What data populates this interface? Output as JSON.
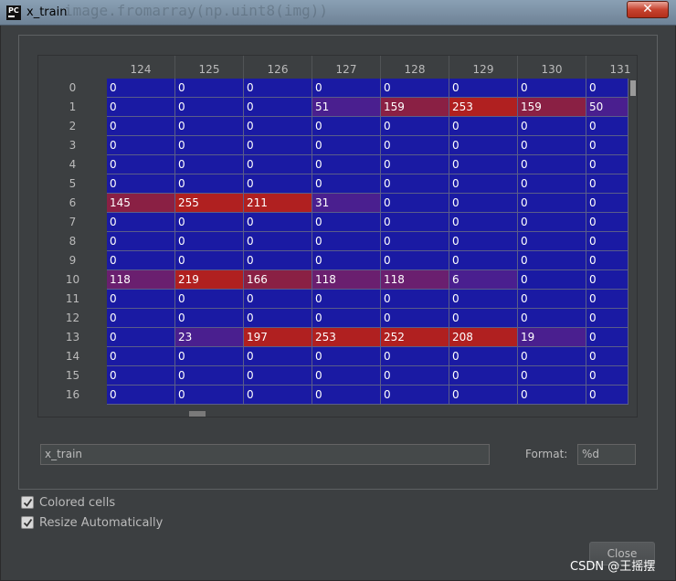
{
  "window": {
    "title": "x_train",
    "background_code": "image.fromarray(np.uint8(img))",
    "app_icon": "pycharm-icon"
  },
  "colors": {
    "zero_cell": "#1a1aa3",
    "high_cell": "#b02020",
    "mid_cell": "#6a1f6f",
    "panel_bg": "#3c3f41"
  },
  "grid": {
    "columns": [
      "124",
      "125",
      "126",
      "127",
      "128",
      "129",
      "130",
      "131"
    ],
    "rows": [
      {
        "label": "0",
        "values": [
          "0",
          "0",
          "0",
          "0",
          "0",
          "0",
          "0",
          "0"
        ]
      },
      {
        "label": "1",
        "values": [
          "0",
          "0",
          "0",
          "51",
          "159",
          "253",
          "159",
          "50"
        ]
      },
      {
        "label": "2",
        "values": [
          "0",
          "0",
          "0",
          "0",
          "0",
          "0",
          "0",
          "0"
        ]
      },
      {
        "label": "3",
        "values": [
          "0",
          "0",
          "0",
          "0",
          "0",
          "0",
          "0",
          "0"
        ]
      },
      {
        "label": "4",
        "values": [
          "0",
          "0",
          "0",
          "0",
          "0",
          "0",
          "0",
          "0"
        ]
      },
      {
        "label": "5",
        "values": [
          "0",
          "0",
          "0",
          "0",
          "0",
          "0",
          "0",
          "0"
        ]
      },
      {
        "label": "6",
        "values": [
          "145",
          "255",
          "211",
          "31",
          "0",
          "0",
          "0",
          "0"
        ]
      },
      {
        "label": "7",
        "values": [
          "0",
          "0",
          "0",
          "0",
          "0",
          "0",
          "0",
          "0"
        ]
      },
      {
        "label": "8",
        "values": [
          "0",
          "0",
          "0",
          "0",
          "0",
          "0",
          "0",
          "0"
        ]
      },
      {
        "label": "9",
        "values": [
          "0",
          "0",
          "0",
          "0",
          "0",
          "0",
          "0",
          "0"
        ]
      },
      {
        "label": "10",
        "values": [
          "118",
          "219",
          "166",
          "118",
          "118",
          "6",
          "0",
          "0"
        ]
      },
      {
        "label": "11",
        "values": [
          "0",
          "0",
          "0",
          "0",
          "0",
          "0",
          "0",
          "0"
        ]
      },
      {
        "label": "12",
        "values": [
          "0",
          "0",
          "0",
          "0",
          "0",
          "0",
          "0",
          "0"
        ]
      },
      {
        "label": "13",
        "values": [
          "0",
          "23",
          "197",
          "253",
          "252",
          "208",
          "19",
          "0"
        ]
      },
      {
        "label": "14",
        "values": [
          "0",
          "0",
          "0",
          "0",
          "0",
          "0",
          "0",
          "0"
        ]
      },
      {
        "label": "15",
        "values": [
          "0",
          "0",
          "0",
          "0",
          "0",
          "0",
          "0",
          "0"
        ]
      },
      {
        "label": "16",
        "values": [
          "0",
          "0",
          "0",
          "0",
          "0",
          "0",
          "0",
          "0"
        ]
      }
    ]
  },
  "name_field": {
    "value": "x_train"
  },
  "format": {
    "label": "Format:",
    "value": "%d"
  },
  "options": [
    {
      "label": "Colored cells",
      "checked": true
    },
    {
      "label": "Resize Automatically",
      "checked": true
    }
  ],
  "buttons": {
    "close": "Close",
    "title_close": "✕"
  },
  "watermark": "CSDN @王摇摆"
}
